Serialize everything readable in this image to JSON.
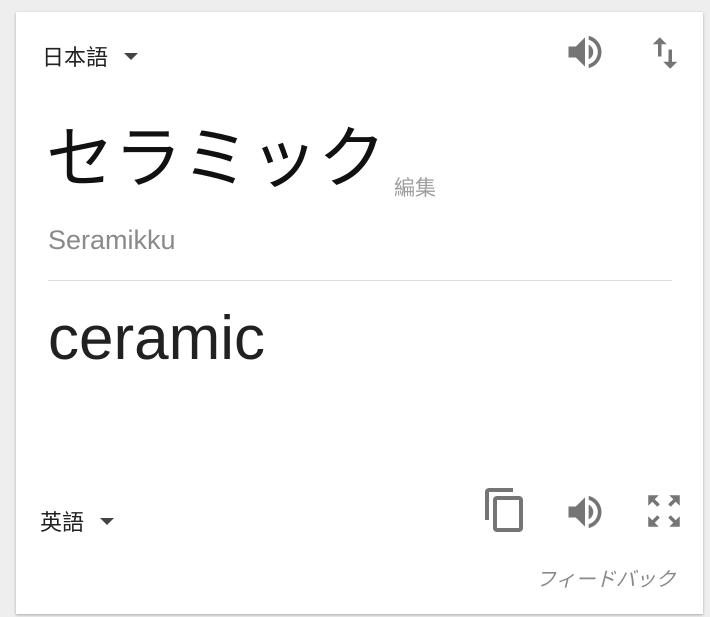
{
  "source": {
    "language": "日本語",
    "text": "セラミック",
    "edit_label": "編集",
    "romanization": "Seramikku"
  },
  "target": {
    "language": "英語",
    "text": "ceramic"
  },
  "feedback_label": "フィードバック",
  "icons": {
    "source_speaker": "speaker-icon",
    "swap": "swap-languages-icon",
    "copy": "copy-icon",
    "target_speaker": "speaker-icon",
    "expand": "fullscreen-icon"
  },
  "colors": {
    "icon": "#757575",
    "text_primary": "#212121",
    "text_secondary": "#8a8a8a"
  }
}
